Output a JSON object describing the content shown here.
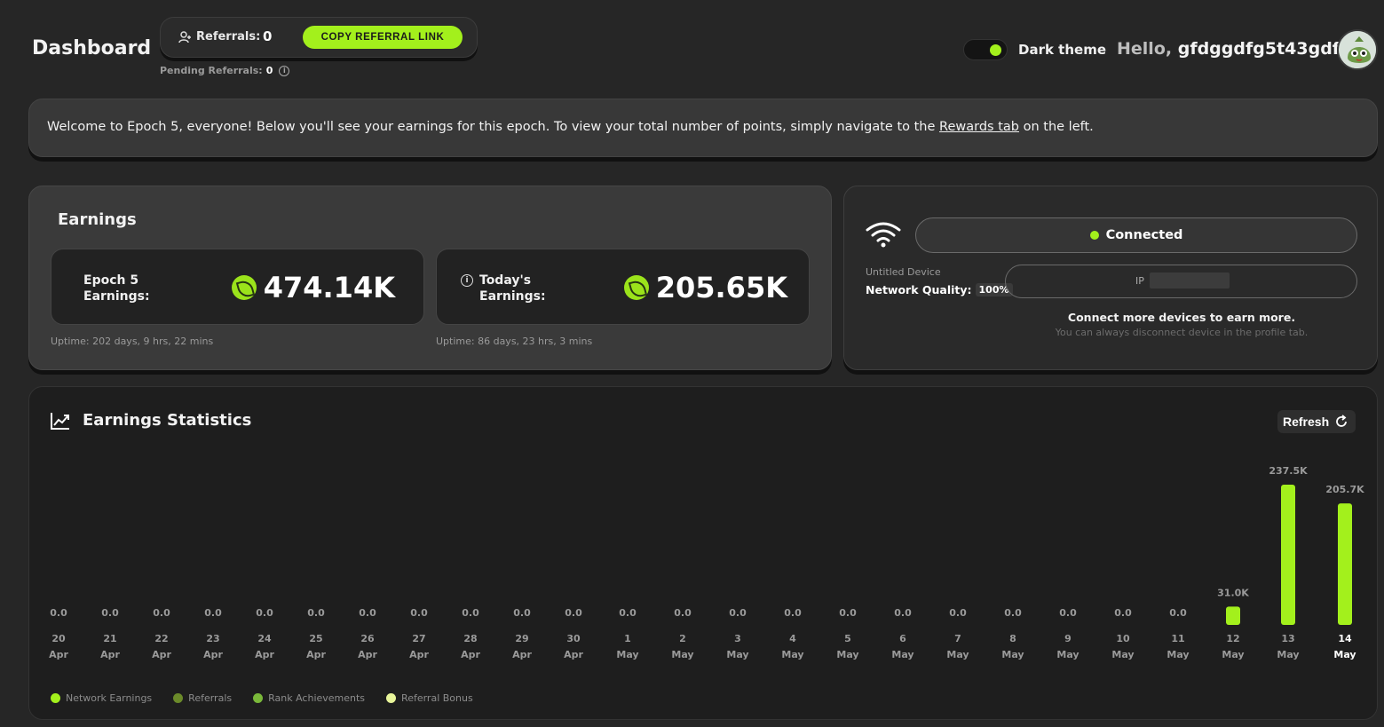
{
  "header": {
    "title": "Dashboard",
    "referrals_label": "Referrals:",
    "referrals_count": "0",
    "copy_button": "COPY REFERRAL LINK",
    "pending_label": "Pending Referrals:",
    "pending_count": "0",
    "theme_label": "Dark theme",
    "greeting": "Hello,",
    "username": "gfdggdfg5t43gdf!"
  },
  "welcome": {
    "text_before": "Welcome to Epoch 5, everyone! Below you'll see your earnings for this epoch. To view your total number of points, simply navigate to the ",
    "link": "Rewards tab",
    "text_after": " on the left."
  },
  "earnings": {
    "title": "Earnings",
    "epoch_label_1": "Epoch 5",
    "epoch_label_2": "Earnings:",
    "epoch_value": "474.14K",
    "epoch_uptime": "Uptime: 202 days, 9 hrs, 22 mins",
    "today_label_1": "Today's",
    "today_label_2": "Earnings:",
    "today_value": "205.65K",
    "today_uptime": "Uptime: 86 days, 23 hrs, 3 mins"
  },
  "device": {
    "status": "Connected",
    "name": "Untitled Device",
    "network_quality_label": "Network Quality:",
    "network_quality_value": "100%",
    "ip_label": "IP",
    "connect_more": "Connect more devices to earn more.",
    "disconnect_hint": "You can always disconnect device in the profile tab."
  },
  "stats": {
    "title": "Earnings Statistics",
    "refresh_label": "Refresh"
  },
  "colors": {
    "accent": "#a3f01c",
    "referrals": "#6b8a2a",
    "rank": "#7ab83a",
    "bonus": "#e8f59a"
  },
  "chart_data": {
    "type": "bar",
    "categories": [
      [
        "20",
        "Apr"
      ],
      [
        "21",
        "Apr"
      ],
      [
        "22",
        "Apr"
      ],
      [
        "23",
        "Apr"
      ],
      [
        "24",
        "Apr"
      ],
      [
        "25",
        "Apr"
      ],
      [
        "26",
        "Apr"
      ],
      [
        "27",
        "Apr"
      ],
      [
        "28",
        "Apr"
      ],
      [
        "29",
        "Apr"
      ],
      [
        "30",
        "Apr"
      ],
      [
        "1",
        "May"
      ],
      [
        "2",
        "May"
      ],
      [
        "3",
        "May"
      ],
      [
        "4",
        "May"
      ],
      [
        "5",
        "May"
      ],
      [
        "6",
        "May"
      ],
      [
        "7",
        "May"
      ],
      [
        "8",
        "May"
      ],
      [
        "9",
        "May"
      ],
      [
        "10",
        "May"
      ],
      [
        "11",
        "May"
      ],
      [
        "12",
        "May"
      ],
      [
        "13",
        "May"
      ],
      [
        "14",
        "May"
      ]
    ],
    "values": [
      0,
      0,
      0,
      0,
      0,
      0,
      0,
      0,
      0,
      0,
      0,
      0,
      0,
      0,
      0,
      0,
      0,
      0,
      0,
      0,
      0,
      0,
      31000,
      237500,
      205700
    ],
    "value_labels": [
      "0.0",
      "0.0",
      "0.0",
      "0.0",
      "0.0",
      "0.0",
      "0.0",
      "0.0",
      "0.0",
      "0.0",
      "0.0",
      "0.0",
      "0.0",
      "0.0",
      "0.0",
      "0.0",
      "0.0",
      "0.0",
      "0.0",
      "0.0",
      "0.0",
      "0.0",
      "31.0K",
      "237.5K",
      "205.7K"
    ],
    "ylim": [
      0,
      237500
    ],
    "grid": false,
    "legend": [
      "Network Earnings",
      "Referrals",
      "Rank Achievements",
      "Referral Bonus"
    ],
    "legend_position": "bottom-left"
  }
}
